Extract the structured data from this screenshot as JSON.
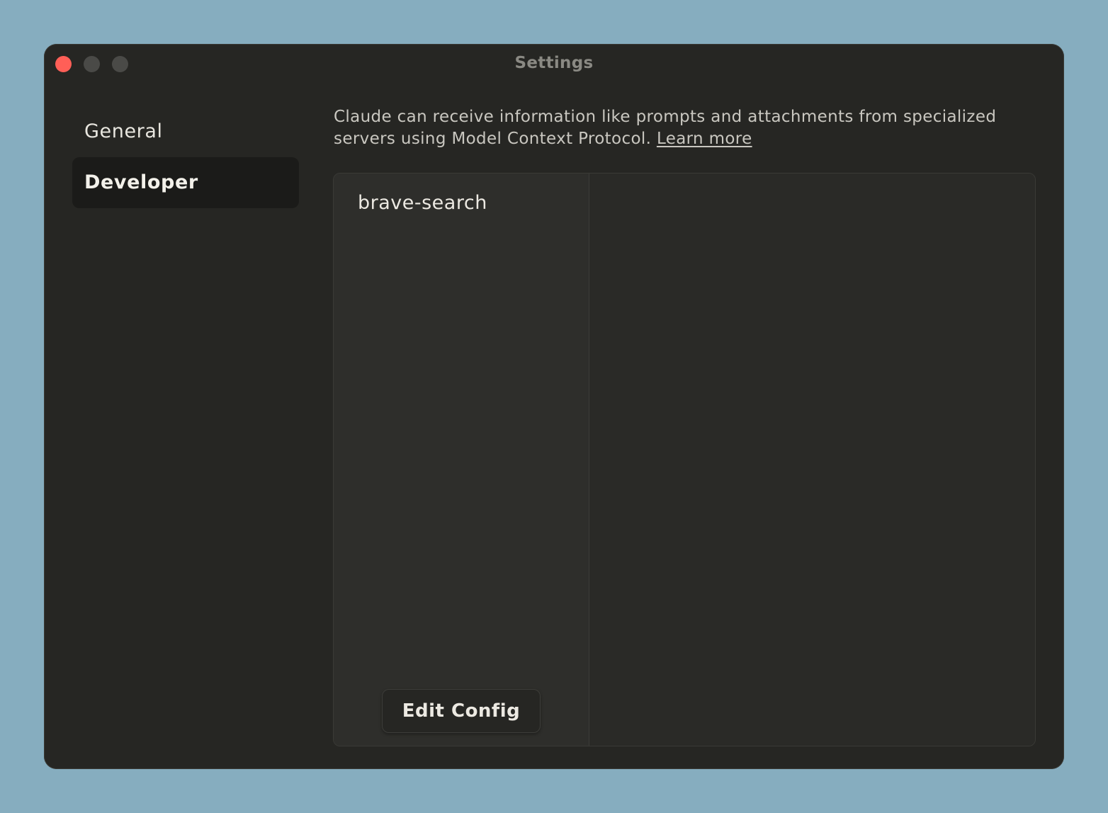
{
  "window": {
    "title": "Settings"
  },
  "sidebar": {
    "items": [
      {
        "label": "General",
        "active": false
      },
      {
        "label": "Developer",
        "active": true
      }
    ]
  },
  "main": {
    "description_text": "Claude can receive information like prompts and attachments from specialized servers using Model Context Protocol. ",
    "learn_more_label": "Learn more",
    "servers": [
      {
        "name": "brave-search"
      }
    ],
    "edit_config_label": "Edit Config"
  },
  "colors": {
    "background": "#86adbf",
    "window": "#262623",
    "active_sidebar": "#1b1b19",
    "close_button": "#ff5f57"
  }
}
